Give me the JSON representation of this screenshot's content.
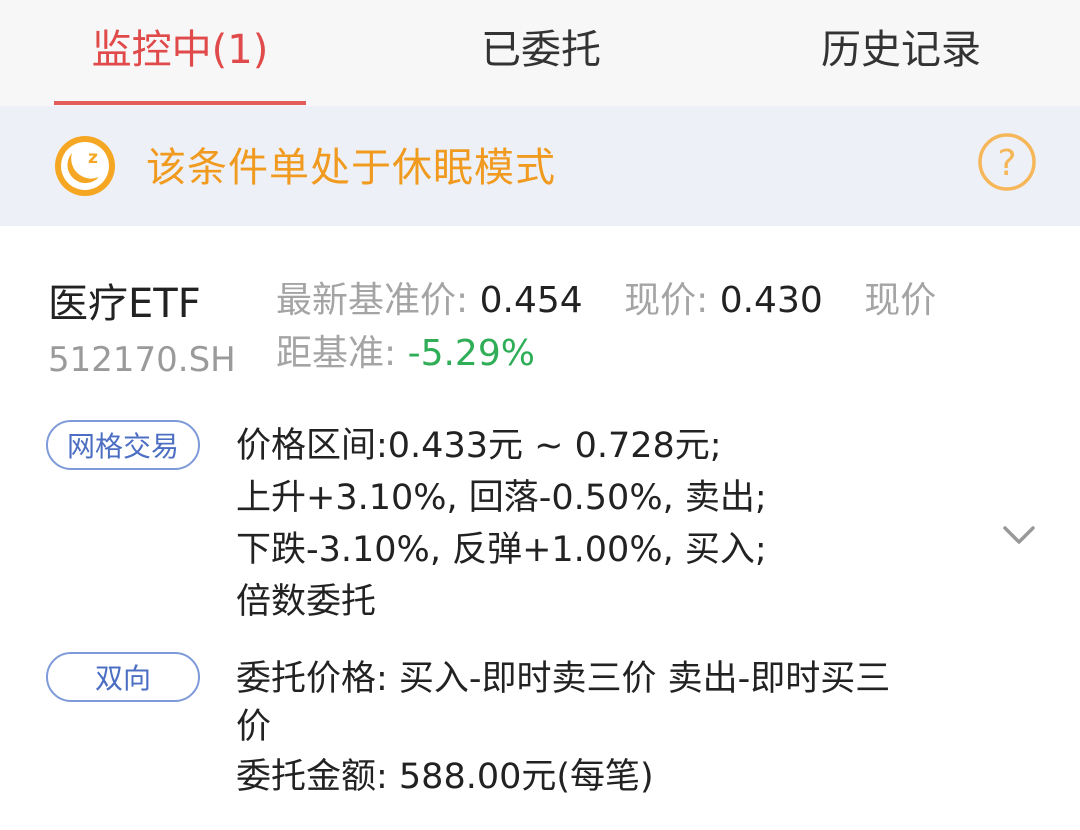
{
  "tabs": [
    {
      "label": "监控中(1)",
      "active": true
    },
    {
      "label": "已委托",
      "active": false
    },
    {
      "label": "历史记录",
      "active": false
    }
  ],
  "notice": {
    "icon": "moon-sleep-icon",
    "text": "该条件单处于休眠模式",
    "help_icon": "help-icon",
    "color": "#f09b1f"
  },
  "stock": {
    "name": "医疗ETF",
    "code": "512170.SH",
    "latest_base_label": "最新基准价:",
    "latest_base_value": "0.454",
    "current_price_label": "现价:",
    "current_price_value": "0.430",
    "current_price_trailing": "现价",
    "distance_label": "距基准:",
    "distance_value": "-5.29%",
    "distance_color": "#2fae57"
  },
  "strategy": {
    "tag": "网格交易",
    "lines": [
      "价格区间:0.433元 ~ 0.728元;",
      "上升+3.10%, 回落-0.50%, 卖出;",
      "下跌-3.10%, 反弹+1.00%, 买入;",
      "倍数委托"
    ],
    "expand_icon": "chevron-down-icon"
  },
  "order": {
    "tag": "双向",
    "lines": [
      "委托价格: 买入-即时卖三价 卖出-即时买三",
      "价",
      "委托金额: 588.00元(每笔)"
    ]
  }
}
